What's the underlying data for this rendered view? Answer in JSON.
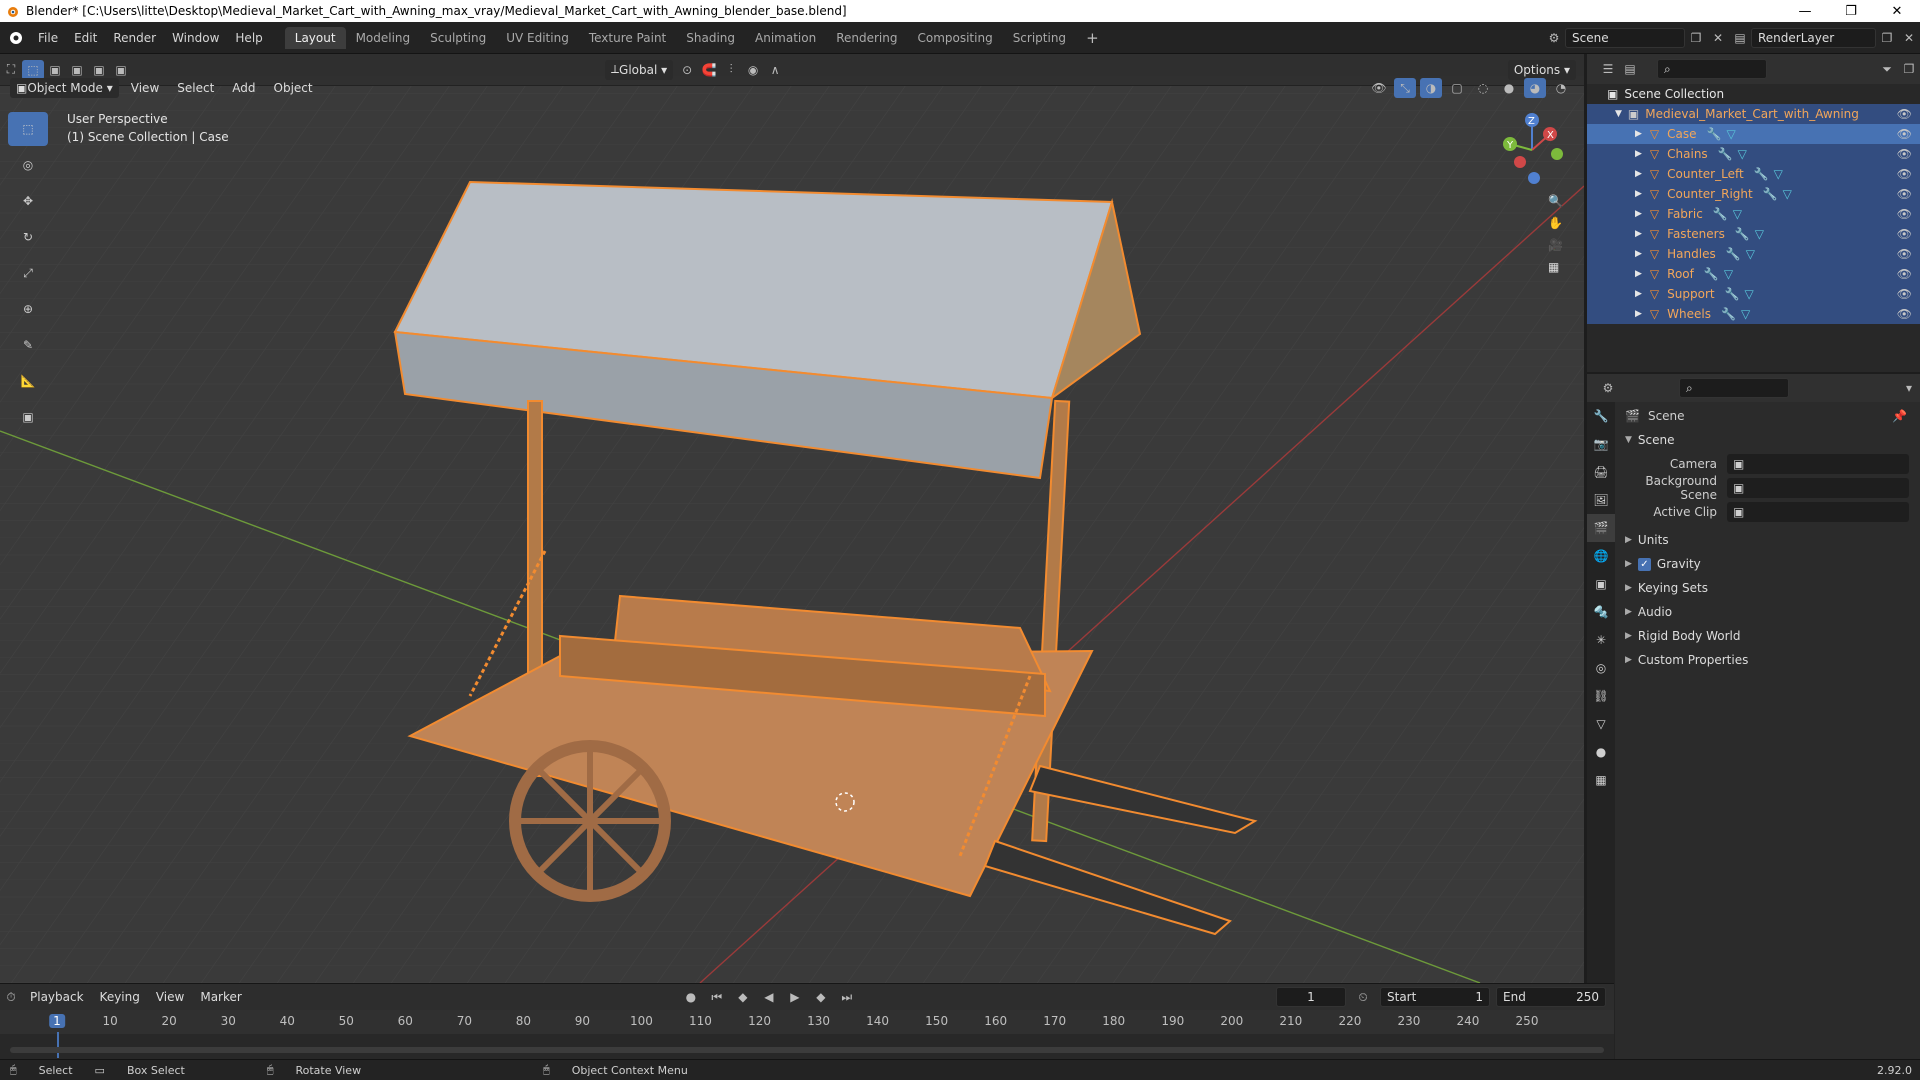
{
  "window": {
    "title": "Blender* [C:\\Users\\litte\\Desktop\\Medieval_Market_Cart_with_Awning_max_vray/Medieval_Market_Cart_with_Awning_blender_base.blend]"
  },
  "menu": [
    "File",
    "Edit",
    "Render",
    "Window",
    "Help"
  ],
  "workspaces": [
    {
      "label": "Layout",
      "active": true
    },
    {
      "label": "Modeling"
    },
    {
      "label": "Sculpting"
    },
    {
      "label": "UV Editing"
    },
    {
      "label": "Texture Paint"
    },
    {
      "label": "Shading"
    },
    {
      "label": "Animation"
    },
    {
      "label": "Rendering"
    },
    {
      "label": "Compositing"
    },
    {
      "label": "Scripting"
    }
  ],
  "top": {
    "scene": "Scene",
    "render_layer": "RenderLayer"
  },
  "viewport": {
    "mode": "Object Mode",
    "menus": [
      "View",
      "Select",
      "Add",
      "Object"
    ],
    "transform": "Global",
    "options": "Options",
    "perspective": "User Perspective",
    "collection": "(1) Scene Collection | Case"
  },
  "outliner": {
    "root": "Scene Collection",
    "collection": "Medieval_Market_Cart_with_Awning",
    "items": [
      "Case",
      "Chains",
      "Counter_Left",
      "Counter_Right",
      "Fabric",
      "Fasteners",
      "Handles",
      "Roof",
      "Support",
      "Wheels"
    ]
  },
  "properties": {
    "context": "Scene",
    "section": "Scene",
    "fields": [
      {
        "label": "Camera",
        "value": ""
      },
      {
        "label": "Background Scene",
        "value": ""
      },
      {
        "label": "Active Clip",
        "value": ""
      }
    ],
    "panels": [
      "Units",
      "Gravity",
      "Keying Sets",
      "Audio",
      "Rigid Body World",
      "Custom Properties"
    ],
    "gravity_checked": true
  },
  "timeline": {
    "menus": [
      "Playback",
      "Keying",
      "View",
      "Marker"
    ],
    "current_frame": "1",
    "start_label": "Start",
    "start": "1",
    "end_label": "End",
    "end": "250",
    "ticks": [
      "1",
      "10",
      "20",
      "30",
      "40",
      "50",
      "60",
      "70",
      "80",
      "90",
      "100",
      "110",
      "120",
      "130",
      "140",
      "150",
      "160",
      "170",
      "180",
      "190",
      "200",
      "210",
      "220",
      "230",
      "240",
      "250"
    ]
  },
  "status": {
    "select": "Select",
    "box_select": "Box Select",
    "rotate": "Rotate View",
    "context_menu": "Object Context Menu",
    "version": "2.92.0"
  },
  "colors": {
    "accent": "#4772b3",
    "selected_orange": "#f28b30",
    "outliner_text": "#f2a65a"
  }
}
